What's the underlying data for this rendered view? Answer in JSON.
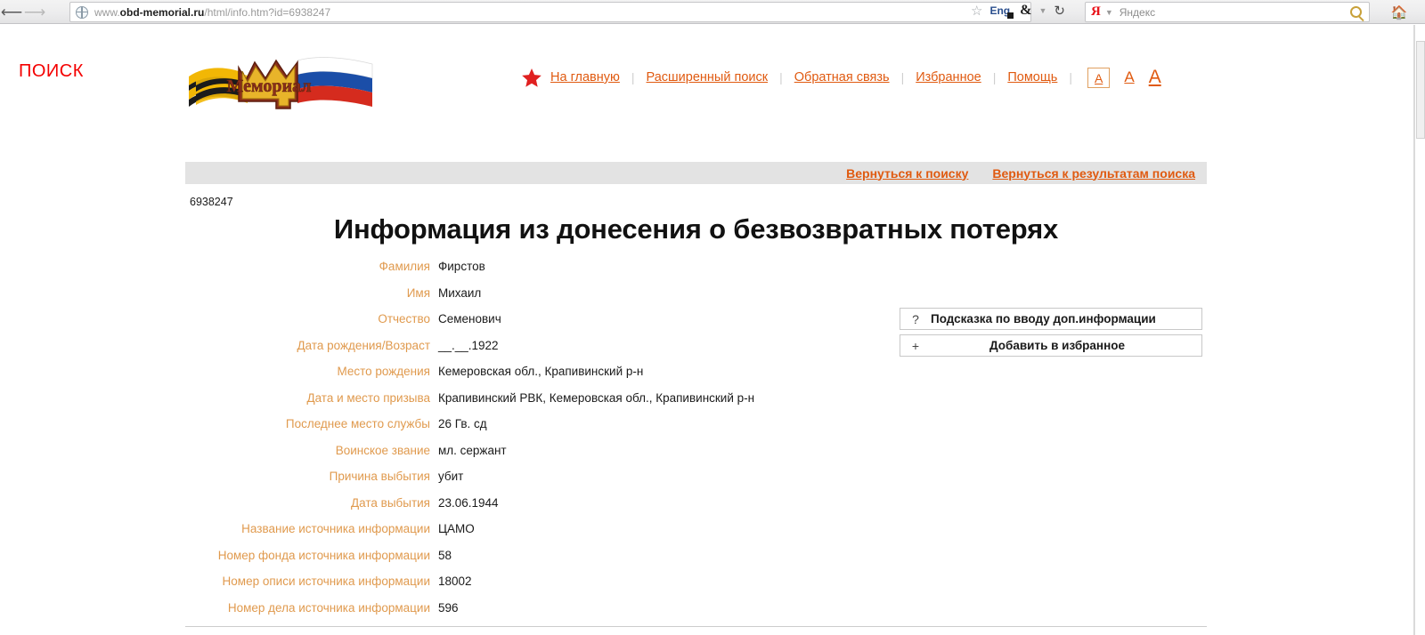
{
  "browser": {
    "back_icon": "back-arrow-icon",
    "forward_icon": "forward-arrow-icon",
    "url_prefix": "www.",
    "url_domain": "obd-memorial.ru",
    "url_path": "/html/info.htm?id=6938247",
    "url_full": "www.obd-memorial.ru/html/info.htm?id=6938247",
    "bookmark_icon": "star-icon",
    "translate_icon": "eng-translate-icon",
    "extension_icon": "ampersand-icon",
    "dropdown_icon": "chevron-down-icon",
    "reload_icon": "reload-icon",
    "search_engine": "Я",
    "search_placeholder": "Яндекс",
    "search_value": "",
    "search_icon": "magnifier-icon",
    "home_icon": "home-icon"
  },
  "page": {
    "left_label": "ПОИСК",
    "logo_text": "Мемориал",
    "logo_alt": "memorial-logo"
  },
  "nav": {
    "star_icon": "red-star-icon",
    "links": [
      {
        "label": "На главную"
      },
      {
        "label": "Расширенный поиск"
      },
      {
        "label": "Обратная связь"
      },
      {
        "label": "Избранное"
      },
      {
        "label": "Помощь"
      }
    ],
    "separator": "|",
    "font_sizes": [
      {
        "label": "A",
        "selected": true
      },
      {
        "label": "A",
        "selected": false
      },
      {
        "label": "A",
        "selected": false
      }
    ]
  },
  "return_bar": {
    "back_to_search": "Вернуться к поиску",
    "back_to_results": "Вернуться к результатам поиска"
  },
  "record": {
    "id": "6938247",
    "title": "Информация из донесения о безвозвратных потерях",
    "fields": [
      {
        "label": "Фамилия",
        "value": "Фирстов"
      },
      {
        "label": "Имя",
        "value": "Михаил"
      },
      {
        "label": "Отчество",
        "value": "Семенович"
      },
      {
        "label": "Дата рождения/Возраст",
        "value": "__.__.1922"
      },
      {
        "label": "Место рождения",
        "value": "Кемеровская обл., Крапивинский р-н"
      },
      {
        "label": "Дата и место призыва",
        "value": "Крапивинский РВК, Кемеровская обл., Крапивинский р-н"
      },
      {
        "label": "Последнее место службы",
        "value": "26 Гв. сд"
      },
      {
        "label": "Воинское звание",
        "value": "мл. сержант"
      },
      {
        "label": "Причина выбытия",
        "value": "убит"
      },
      {
        "label": "Дата выбытия",
        "value": "23.06.1944"
      },
      {
        "label": "Название источника информации",
        "value": "ЦАМО"
      },
      {
        "label": "Номер фонда источника информации",
        "value": "58"
      },
      {
        "label": "Номер описи источника информации",
        "value": "18002"
      },
      {
        "label": "Номер дела источника информации",
        "value": "596"
      }
    ]
  },
  "side_buttons": {
    "help": {
      "symbol": "?",
      "label": "Подсказка по вводу доп.информации"
    },
    "favorite": {
      "symbol": "+",
      "label": "Добавить в избранное"
    }
  },
  "colors": {
    "accent_orange": "#e05a10",
    "label_orange": "#e09a4e",
    "red": "#f40000",
    "gray_bar": "#e3e3e3"
  }
}
